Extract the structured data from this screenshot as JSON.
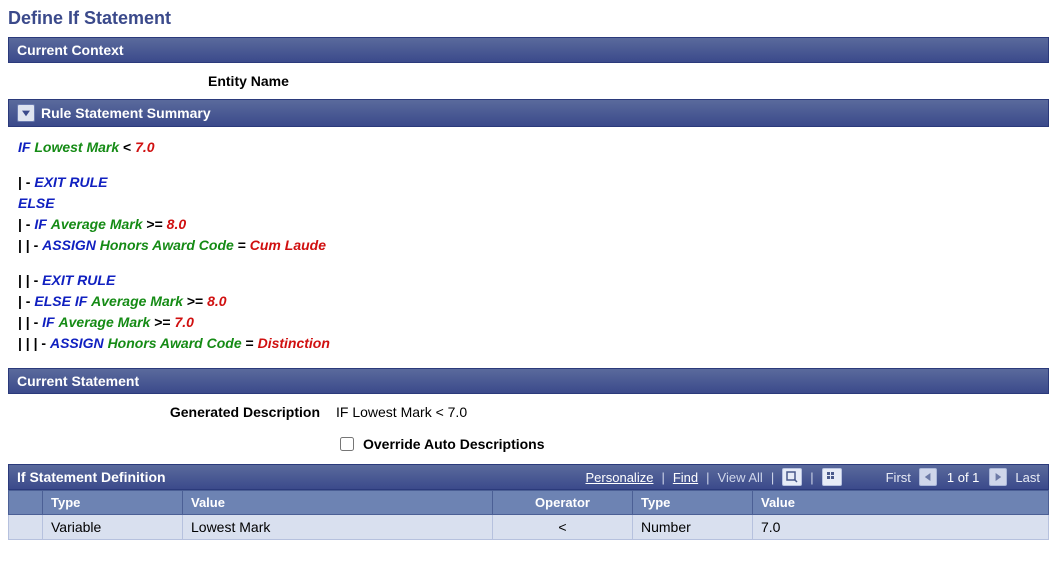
{
  "page_title": "Define If Statement",
  "sections": {
    "current_context": "Current Context",
    "rule_summary": "Rule Statement Summary",
    "current_statement": "Current Statement",
    "grid_title": "If Statement Definition"
  },
  "context": {
    "entity_name_label": "Entity Name"
  },
  "rule": {
    "line1": {
      "if": "IF",
      "var": "Lowest Mark",
      "op": "<",
      "val": "7.0"
    },
    "exit1": {
      "pipe": "| - ",
      "kw": "EXIT RULE"
    },
    "else1": {
      "kw": "ELSE"
    },
    "if2": {
      "pipe": "| - ",
      "kw": "IF",
      "var": "Average Mark",
      "op": ">=",
      "val": "8.0"
    },
    "assign1": {
      "pipe": "|   | - ",
      "kw": "ASSIGN",
      "var": "Honors Award Code",
      "eq": "=",
      "val": "Cum Laude"
    },
    "exit2": {
      "pipe": "|   | - ",
      "kw": "EXIT RULE"
    },
    "elseif": {
      "pipe": "| - ",
      "kw": "ELSE IF",
      "var": "Average Mark",
      "op": ">=",
      "val": "8.0"
    },
    "if3": {
      "pipe": "|   | - ",
      "kw": "IF",
      "var": "Average Mark",
      "op": ">=",
      "val": "7.0"
    },
    "assign2": {
      "pipe": "|   |   | - ",
      "kw": "ASSIGN",
      "var": "Honors Award Code",
      "eq": "=",
      "val": "Distinction"
    }
  },
  "statement": {
    "desc_label": "Generated Description",
    "desc_value": "IF Lowest Mark < 7.0",
    "override_label": "Override Auto Descriptions",
    "override_checked": false
  },
  "grid": {
    "toolbar": {
      "personalize": "Personalize",
      "find": "Find",
      "view_all": "View All",
      "first": "First",
      "count": "1 of 1",
      "last": "Last"
    },
    "headers": {
      "type1": "Type",
      "value1": "Value",
      "operator": "Operator",
      "type2": "Type",
      "value2": "Value"
    },
    "rows": [
      {
        "type1": "Variable",
        "value1": "Lowest Mark",
        "operator": "<",
        "type2": "Number",
        "value2": "7.0"
      }
    ]
  }
}
